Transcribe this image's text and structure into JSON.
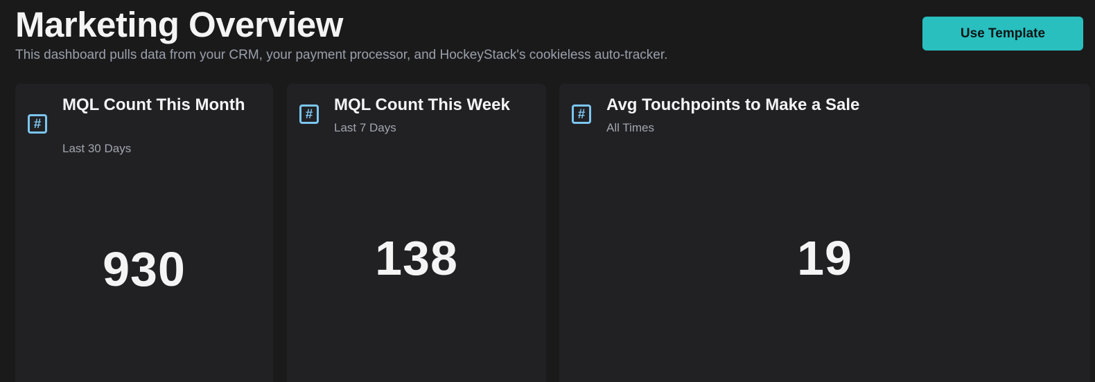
{
  "header": {
    "title": "Marketing Overview",
    "subtitle": "This dashboard pulls data from your CRM, your payment processor, and HockeyStack's cookieless auto-tracker.",
    "use_template_label": "Use Template"
  },
  "cards": [
    {
      "icon": "hash-icon",
      "icon_glyph": "#",
      "title": "MQL Count This Month",
      "subtitle": "Last 30 Days",
      "value": "930"
    },
    {
      "icon": "hash-icon",
      "icon_glyph": "#",
      "title": "MQL Count This Week",
      "subtitle": "Last 7 Days",
      "value": "138"
    },
    {
      "icon": "hash-icon",
      "icon_glyph": "#",
      "title": "Avg Touchpoints to Make a Sale",
      "subtitle": "All Times",
      "value": "19"
    }
  ],
  "colors": {
    "background": "#1a1a1b",
    "card_background": "#212124",
    "accent": "#29bfbf",
    "icon": "#7cc6f0"
  }
}
